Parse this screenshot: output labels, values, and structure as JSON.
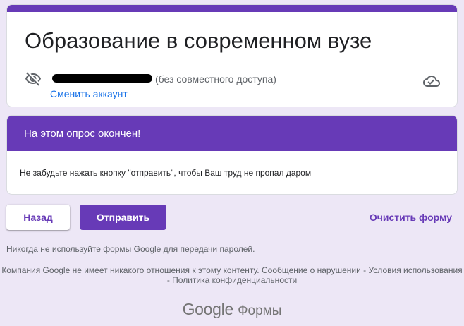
{
  "form": {
    "title": "Образование в современном вузе",
    "sharing_note": "(без совместного доступа)",
    "switch_account": "Сменить аккаунт"
  },
  "section": {
    "title": "На этом опрос окончен!",
    "description": "Не забудьте нажать кнопку \"отправить\", чтобы Ваш труд не пропал даром"
  },
  "actions": {
    "back_label": "Назад",
    "submit_label": "Отправить",
    "clear_label": "Очистить форму"
  },
  "footer": {
    "password_warning": "Никогда не используйте формы Google для передачи паролей.",
    "disclaimer": "Компания Google не имеет никакого отношения к этому контенту.",
    "separator": " - ",
    "report_link": "Сообщение о нарушении",
    "terms_link": "Условия использования",
    "privacy_link": "Политика конфиденциальности",
    "brand_google": "Google",
    "brand_forms": "Формы"
  },
  "icons": {
    "hidden": "eye-off-icon",
    "cloud": "cloud-saved-icon"
  },
  "colors": {
    "accent": "#673ab7",
    "background": "#ede7f6",
    "link": "#1a73e8"
  }
}
